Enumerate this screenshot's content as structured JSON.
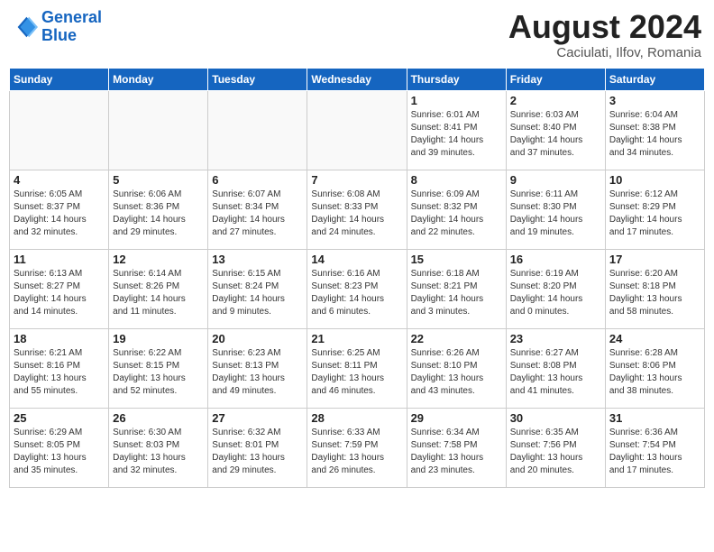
{
  "header": {
    "logo_line1": "General",
    "logo_line2": "Blue",
    "title": "August 2024",
    "subtitle": "Caciulati, Ilfov, Romania"
  },
  "weekdays": [
    "Sunday",
    "Monday",
    "Tuesday",
    "Wednesday",
    "Thursday",
    "Friday",
    "Saturday"
  ],
  "weeks": [
    [
      {
        "day": "",
        "info": ""
      },
      {
        "day": "",
        "info": ""
      },
      {
        "day": "",
        "info": ""
      },
      {
        "day": "",
        "info": ""
      },
      {
        "day": "1",
        "info": "Sunrise: 6:01 AM\nSunset: 8:41 PM\nDaylight: 14 hours\nand 39 minutes."
      },
      {
        "day": "2",
        "info": "Sunrise: 6:03 AM\nSunset: 8:40 PM\nDaylight: 14 hours\nand 37 minutes."
      },
      {
        "day": "3",
        "info": "Sunrise: 6:04 AM\nSunset: 8:38 PM\nDaylight: 14 hours\nand 34 minutes."
      }
    ],
    [
      {
        "day": "4",
        "info": "Sunrise: 6:05 AM\nSunset: 8:37 PM\nDaylight: 14 hours\nand 32 minutes."
      },
      {
        "day": "5",
        "info": "Sunrise: 6:06 AM\nSunset: 8:36 PM\nDaylight: 14 hours\nand 29 minutes."
      },
      {
        "day": "6",
        "info": "Sunrise: 6:07 AM\nSunset: 8:34 PM\nDaylight: 14 hours\nand 27 minutes."
      },
      {
        "day": "7",
        "info": "Sunrise: 6:08 AM\nSunset: 8:33 PM\nDaylight: 14 hours\nand 24 minutes."
      },
      {
        "day": "8",
        "info": "Sunrise: 6:09 AM\nSunset: 8:32 PM\nDaylight: 14 hours\nand 22 minutes."
      },
      {
        "day": "9",
        "info": "Sunrise: 6:11 AM\nSunset: 8:30 PM\nDaylight: 14 hours\nand 19 minutes."
      },
      {
        "day": "10",
        "info": "Sunrise: 6:12 AM\nSunset: 8:29 PM\nDaylight: 14 hours\nand 17 minutes."
      }
    ],
    [
      {
        "day": "11",
        "info": "Sunrise: 6:13 AM\nSunset: 8:27 PM\nDaylight: 14 hours\nand 14 minutes."
      },
      {
        "day": "12",
        "info": "Sunrise: 6:14 AM\nSunset: 8:26 PM\nDaylight: 14 hours\nand 11 minutes."
      },
      {
        "day": "13",
        "info": "Sunrise: 6:15 AM\nSunset: 8:24 PM\nDaylight: 14 hours\nand 9 minutes."
      },
      {
        "day": "14",
        "info": "Sunrise: 6:16 AM\nSunset: 8:23 PM\nDaylight: 14 hours\nand 6 minutes."
      },
      {
        "day": "15",
        "info": "Sunrise: 6:18 AM\nSunset: 8:21 PM\nDaylight: 14 hours\nand 3 minutes."
      },
      {
        "day": "16",
        "info": "Sunrise: 6:19 AM\nSunset: 8:20 PM\nDaylight: 14 hours\nand 0 minutes."
      },
      {
        "day": "17",
        "info": "Sunrise: 6:20 AM\nSunset: 8:18 PM\nDaylight: 13 hours\nand 58 minutes."
      }
    ],
    [
      {
        "day": "18",
        "info": "Sunrise: 6:21 AM\nSunset: 8:16 PM\nDaylight: 13 hours\nand 55 minutes."
      },
      {
        "day": "19",
        "info": "Sunrise: 6:22 AM\nSunset: 8:15 PM\nDaylight: 13 hours\nand 52 minutes."
      },
      {
        "day": "20",
        "info": "Sunrise: 6:23 AM\nSunset: 8:13 PM\nDaylight: 13 hours\nand 49 minutes."
      },
      {
        "day": "21",
        "info": "Sunrise: 6:25 AM\nSunset: 8:11 PM\nDaylight: 13 hours\nand 46 minutes."
      },
      {
        "day": "22",
        "info": "Sunrise: 6:26 AM\nSunset: 8:10 PM\nDaylight: 13 hours\nand 43 minutes."
      },
      {
        "day": "23",
        "info": "Sunrise: 6:27 AM\nSunset: 8:08 PM\nDaylight: 13 hours\nand 41 minutes."
      },
      {
        "day": "24",
        "info": "Sunrise: 6:28 AM\nSunset: 8:06 PM\nDaylight: 13 hours\nand 38 minutes."
      }
    ],
    [
      {
        "day": "25",
        "info": "Sunrise: 6:29 AM\nSunset: 8:05 PM\nDaylight: 13 hours\nand 35 minutes."
      },
      {
        "day": "26",
        "info": "Sunrise: 6:30 AM\nSunset: 8:03 PM\nDaylight: 13 hours\nand 32 minutes."
      },
      {
        "day": "27",
        "info": "Sunrise: 6:32 AM\nSunset: 8:01 PM\nDaylight: 13 hours\nand 29 minutes."
      },
      {
        "day": "28",
        "info": "Sunrise: 6:33 AM\nSunset: 7:59 PM\nDaylight: 13 hours\nand 26 minutes."
      },
      {
        "day": "29",
        "info": "Sunrise: 6:34 AM\nSunset: 7:58 PM\nDaylight: 13 hours\nand 23 minutes."
      },
      {
        "day": "30",
        "info": "Sunrise: 6:35 AM\nSunset: 7:56 PM\nDaylight: 13 hours\nand 20 minutes."
      },
      {
        "day": "31",
        "info": "Sunrise: 6:36 AM\nSunset: 7:54 PM\nDaylight: 13 hours\nand 17 minutes."
      }
    ]
  ]
}
